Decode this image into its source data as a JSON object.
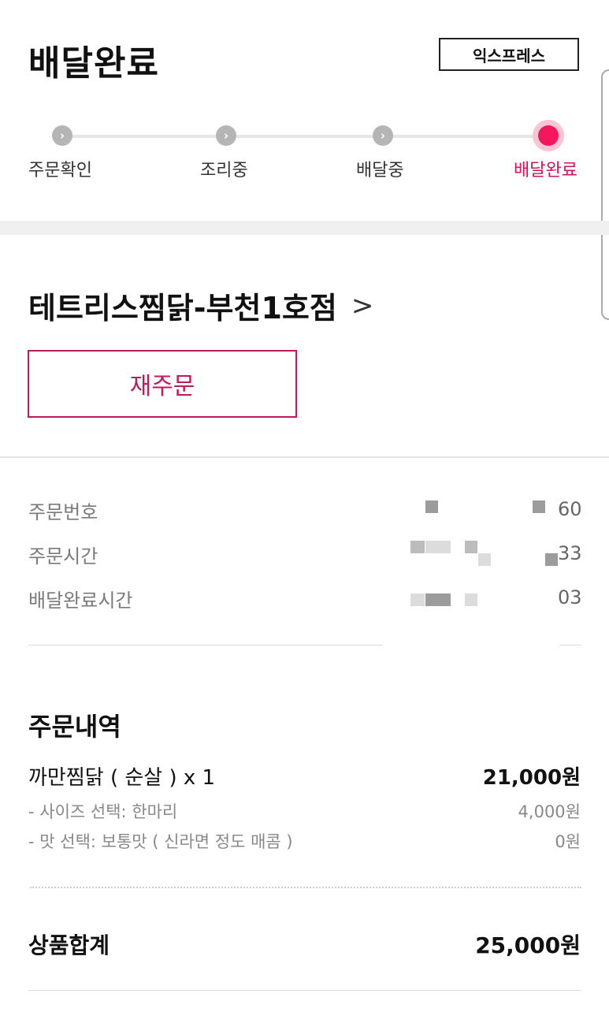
{
  "header": {
    "title": "배달완료",
    "express_label": "익스프레스"
  },
  "progress": {
    "steps": [
      {
        "label": "주문확인",
        "icon": "chevron-right-icon",
        "active": false
      },
      {
        "label": "조리중",
        "icon": "chevron-right-icon",
        "active": false
      },
      {
        "label": "배달중",
        "icon": "chevron-right-icon",
        "active": false
      },
      {
        "label": "배달완료",
        "icon": "active-dot",
        "active": true
      }
    ],
    "active_color": "#f2175f"
  },
  "store": {
    "name": "테트리스찜닭-부천1호점",
    "chevron": ">"
  },
  "reorder": {
    "label": "재주문",
    "color": "#c0195c"
  },
  "order_info": {
    "order_number_label": "주문번호",
    "order_number_suffix": "60",
    "order_time_label": "주문시간",
    "order_time_suffix": "33",
    "delivered_time_label": "배달완료시간",
    "delivered_time_suffix": "03"
  },
  "order_details": {
    "title": "주문내역",
    "item": {
      "name": "까만찜닭 ( 순살 ) x 1",
      "price": "21,000원",
      "options": [
        {
          "label": "- 사이즈 선택: 한마리",
          "price": "4,000원"
        },
        {
          "label": "- 맛 선택: 보통맛 ( 신라면 정도 매콤 )",
          "price": "0원"
        }
      ]
    }
  },
  "summary": {
    "subtotal_label": "상품합계",
    "subtotal_value": "25,000원"
  }
}
